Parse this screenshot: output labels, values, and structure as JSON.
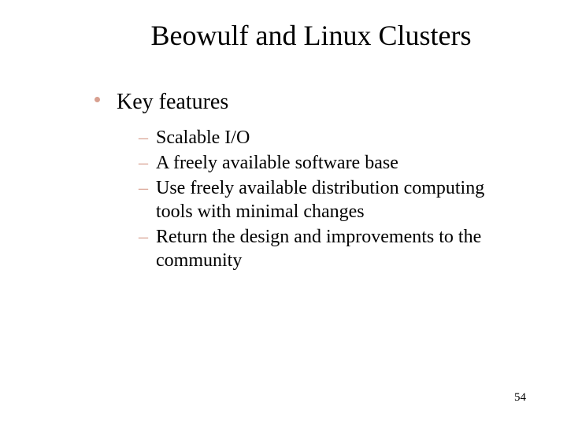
{
  "title": "Beowulf and Linux Clusters",
  "level1": {
    "text": "Key features"
  },
  "level2": [
    "Scalable I/O",
    "A freely available software base",
    "Use freely available distribution computing tools with minimal changes",
    "Return the design and improvements to the community"
  ],
  "pageNumber": "54"
}
